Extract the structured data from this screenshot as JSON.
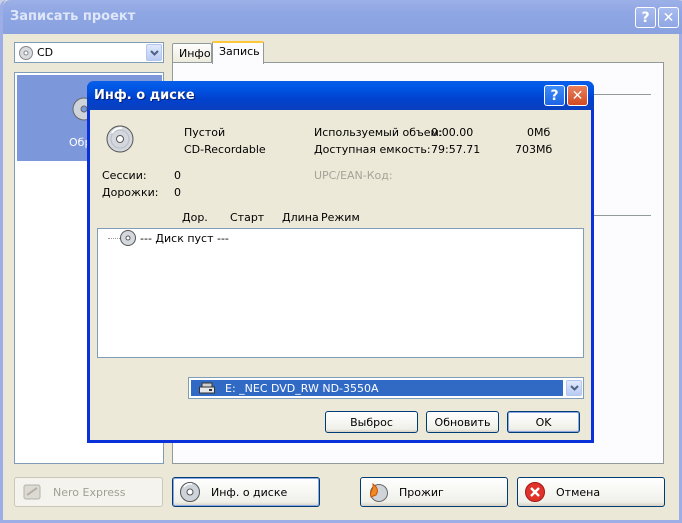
{
  "main_window": {
    "title": "Записать проект",
    "drive_select": "CD",
    "left_item_label": "Обр",
    "tabs": [
      {
        "label": "Инфо"
      },
      {
        "label": "Запись"
      }
    ],
    "buttons": {
      "nero_express": "Nero Express",
      "disc_info": "Инф. о диске",
      "burn": "Прожиг",
      "cancel": "Отмена"
    }
  },
  "dialog": {
    "title": "Инф. о диске",
    "status": "Пустой",
    "disc_type": "CD-Recordable",
    "used_label": "Используемый объем:",
    "used_time": "0:00.00",
    "used_size": "0Мб",
    "avail_label": "Доступная емкость:",
    "avail_time": "79:57.71",
    "avail_size": "703Мб",
    "sessions_label": "Сессии:",
    "sessions_value": "0",
    "tracks_label": "Дорожки:",
    "tracks_value": "0",
    "upc_label": "UPC/EAN-Код:",
    "columns": [
      "Дор.",
      "Старт",
      "Длина",
      "Режим"
    ],
    "tree_row": "--- Диск пуст ---",
    "drive": "E: _NEC DVD_RW ND-3550A",
    "buttons": {
      "eject": "Выброс",
      "refresh": "Обновить",
      "ok": "OK"
    }
  },
  "colors": {
    "dialog_title": "#0054e3",
    "inactive_title": "#8ea6e3",
    "selection": "#316ac5"
  }
}
